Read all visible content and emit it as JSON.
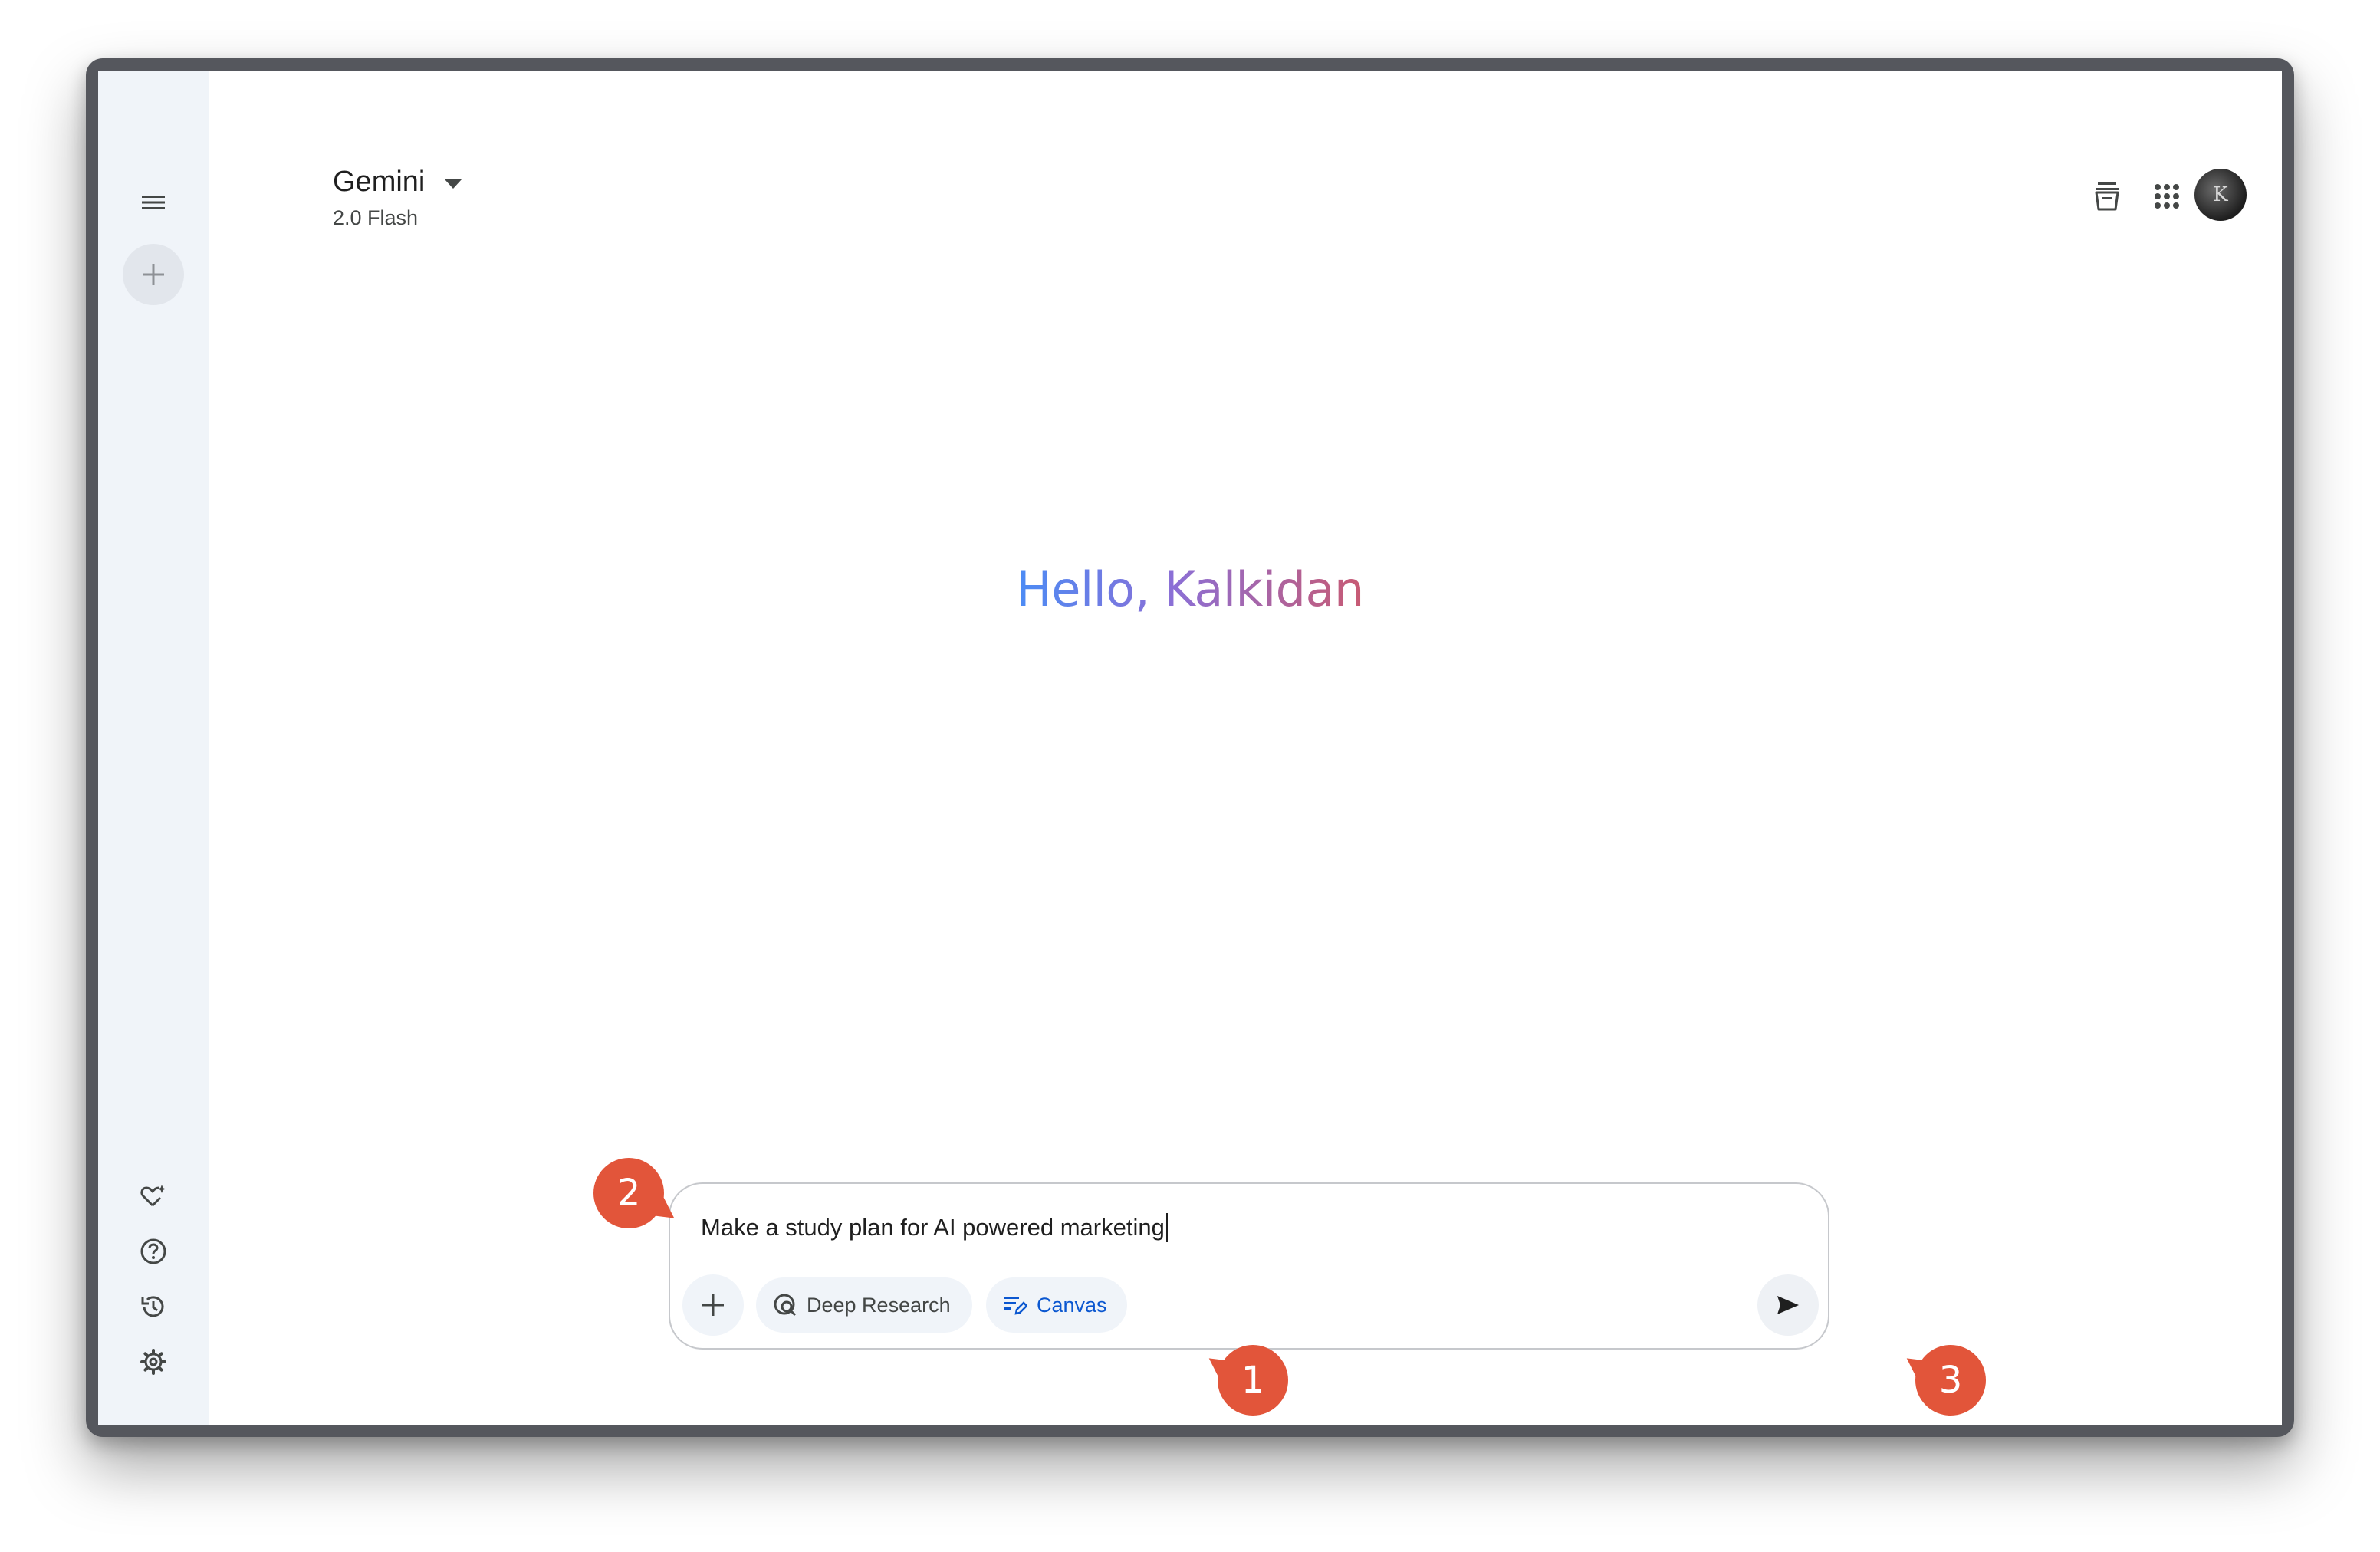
{
  "header": {
    "app_title": "Gemini",
    "model_name": "2.0 Flash"
  },
  "sidebar": {
    "items": [
      {
        "name": "menu",
        "icon": "menu-icon"
      },
      {
        "name": "new-chat",
        "icon": "plus-icon"
      },
      {
        "name": "gem-manager",
        "icon": "gem-heart-icon"
      },
      {
        "name": "help",
        "icon": "help-icon"
      },
      {
        "name": "activity",
        "icon": "history-icon"
      },
      {
        "name": "settings",
        "icon": "gear-icon"
      }
    ]
  },
  "top_right": {
    "icons": [
      "archive-icon",
      "apps-grid-icon"
    ],
    "avatar_initials": "K"
  },
  "greeting": {
    "text": "Hello, Kalkidan"
  },
  "composer": {
    "prompt_text": "Make a study plan for AI powered marketing",
    "chips": {
      "deep_research": "Deep Research",
      "canvas": "Canvas"
    }
  },
  "callouts": {
    "one": "1",
    "two": "2",
    "three": "3"
  },
  "colors": {
    "accent": "#0b57d0",
    "callout": "#e2553a",
    "sidebar_bg": "#f0f4f9",
    "greeting_start": "#4b8cf5",
    "greeting_end": "#c85a72"
  }
}
